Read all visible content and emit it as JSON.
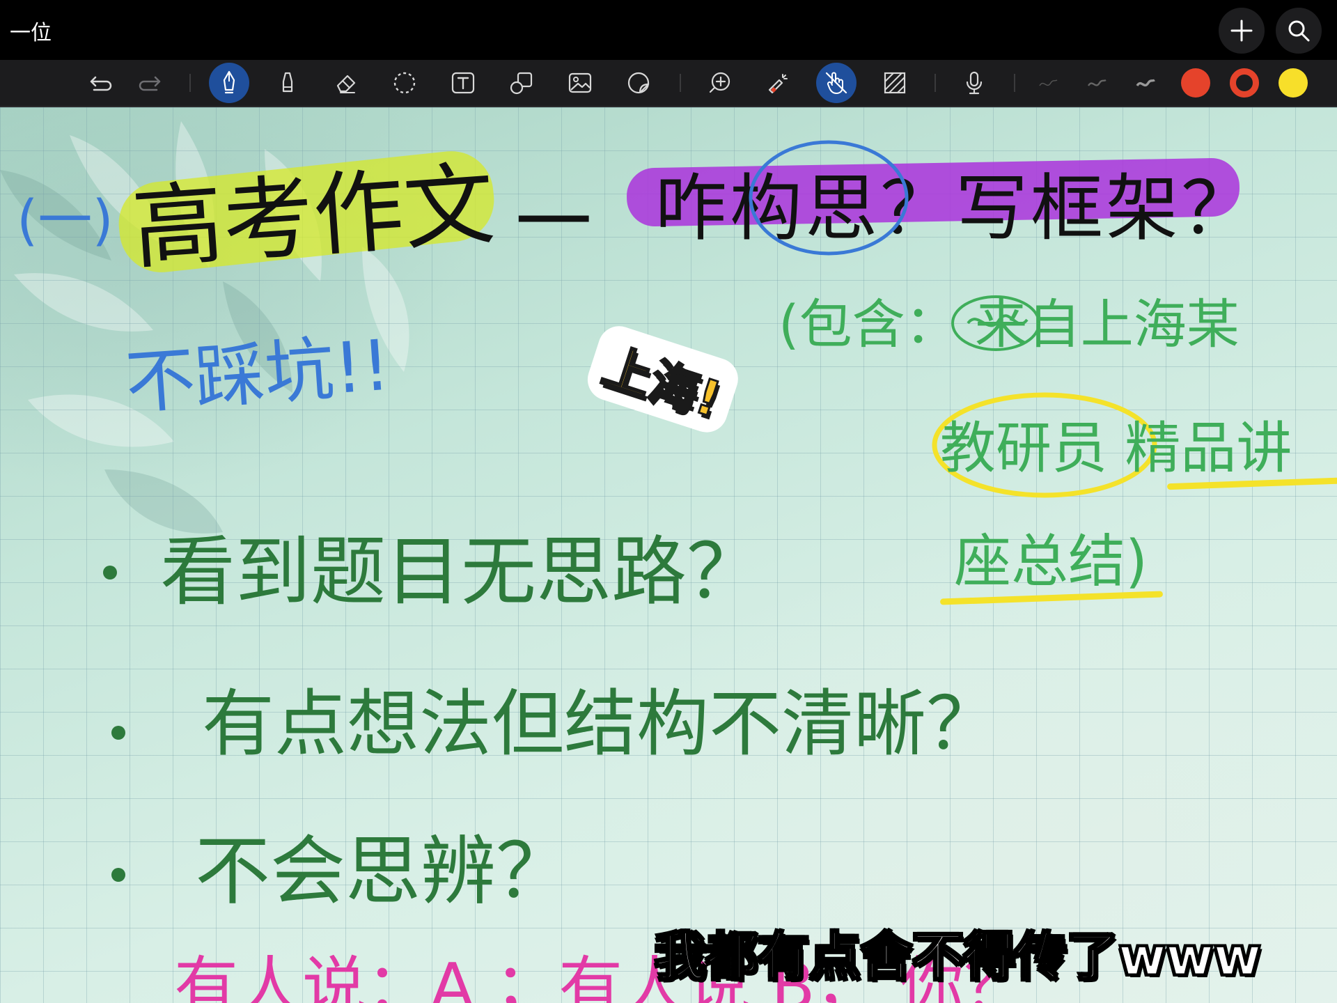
{
  "window": {
    "title": "一位"
  },
  "titlebar_buttons": [
    "add-icon",
    "search-icon"
  ],
  "toolbar": {
    "tools": [
      {
        "name": "undo-icon",
        "active": false
      },
      {
        "name": "redo-icon",
        "active": false
      },
      {
        "name": "pen-icon",
        "active": true
      },
      {
        "name": "highlighter-icon",
        "active": false
      },
      {
        "name": "eraser-icon",
        "active": false
      },
      {
        "name": "lasso-icon",
        "active": false
      },
      {
        "name": "text-icon",
        "active": false
      },
      {
        "name": "shapes-icon",
        "active": false
      },
      {
        "name": "image-icon",
        "active": false
      },
      {
        "name": "sticker-icon",
        "active": false
      },
      {
        "name": "zoom-icon",
        "active": false
      },
      {
        "name": "laser-pointer-icon",
        "active": false
      },
      {
        "name": "hand-draw-icon",
        "active": true
      },
      {
        "name": "hatch-icon",
        "active": false
      },
      {
        "name": "microphone-icon",
        "active": false
      }
    ],
    "colors": [
      "#e5432b",
      "#e5432b",
      "#f7df2a"
    ]
  },
  "note": {
    "heading_prefix": "(一)",
    "heading_main": "高考作文",
    "heading_dash": "一",
    "heading_question": "咋构思？写框架？",
    "no_pitfalls": "不踩坑!!",
    "sticker": "上海!",
    "side_line1": "(包含：  来自上海某",
    "side_line2": "教研员 精品讲",
    "side_line3": "座总结)",
    "bullet1": "看到题目无思路？",
    "bullet2": "有点想法但结构不清晰？",
    "bullet3": "不会思辨？",
    "bottom_line": "有人说：A ；有人说 B， 你？",
    "subtitle": "我都有点舍不得传了www"
  }
}
